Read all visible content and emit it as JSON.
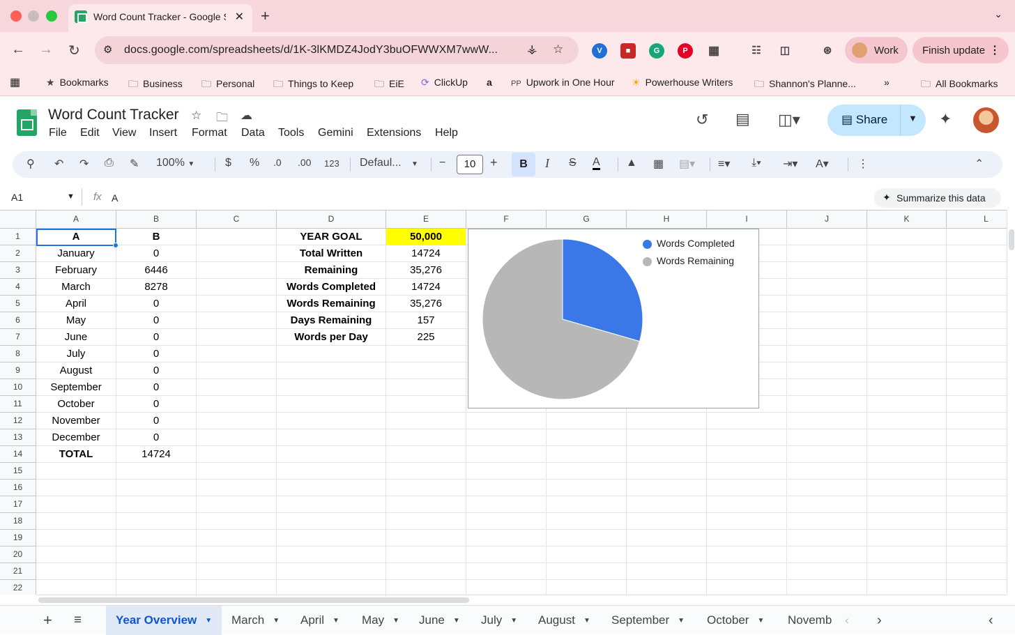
{
  "browser": {
    "tab_title": "Word Count Tracker - Google Sheets",
    "tab_close": "✕",
    "new_tab": "+",
    "url": "docs.google.com/spreadsheets/d/1K-3lKMDZ4JodY3buOFWWXM7wwW...",
    "profile_label": "Work",
    "update_label": "Finish update",
    "colors": {
      "tabstrip": "#f8d7dc",
      "toolbar": "#fde8eb"
    }
  },
  "bookmarks": [
    {
      "label": "Bookmarks",
      "icon": "star-icon"
    },
    {
      "label": "Business",
      "icon": "folder-icon"
    },
    {
      "label": "Personal",
      "icon": "folder-icon"
    },
    {
      "label": "Things to Keep",
      "icon": "folder-icon"
    },
    {
      "label": "EiE",
      "icon": "folder-icon"
    },
    {
      "label": "ClickUp",
      "icon": "clickup-icon"
    },
    {
      "label": "",
      "icon": "amazon-icon"
    },
    {
      "label": "Upwork in One Hour",
      "icon": "upwork-icon"
    },
    {
      "label": "Powerhouse Writers",
      "icon": "powerhouse-icon"
    },
    {
      "label": "Shannon's Planne...",
      "icon": "folder-icon"
    },
    {
      "label": "All Bookmarks",
      "icon": "folder-icon"
    }
  ],
  "sheets": {
    "doc_title": "Word Count Tracker",
    "menu": [
      "File",
      "Edit",
      "View",
      "Insert",
      "Format",
      "Data",
      "Tools",
      "Gemini",
      "Extensions",
      "Help"
    ],
    "share_label": "Share",
    "zoom": "100%",
    "currency": "$",
    "percent": "%",
    "dec_less": ".0",
    "dec_more": ".00",
    "number_format": "123",
    "font": "Defaul...",
    "font_size": "10",
    "name_box": "A1",
    "formula_value": "A",
    "summarize_label": "Summarize this data"
  },
  "grid": {
    "columns": [
      "A",
      "B",
      "C",
      "D",
      "E",
      "F",
      "G",
      "H",
      "I",
      "J",
      "K",
      "L"
    ],
    "rows": [
      "1",
      "2",
      "3",
      "4",
      "5",
      "6",
      "7",
      "8",
      "9",
      "10",
      "11",
      "12",
      "13",
      "14",
      "15",
      "16",
      "17",
      "18",
      "19",
      "20",
      "21",
      "22"
    ],
    "col_a": [
      "A",
      "January",
      "February",
      "March",
      "April",
      "May",
      "June",
      "July",
      "August",
      "September",
      "October",
      "November",
      "December",
      "TOTAL"
    ],
    "col_b": [
      "B",
      "0",
      "6446",
      "8278",
      "0",
      "0",
      "0",
      "0",
      "0",
      "0",
      "0",
      "0",
      "0",
      "14724"
    ],
    "col_d": [
      "YEAR GOAL",
      "Total Written",
      "Remaining",
      "Words Completed",
      "Words Remaining",
      "Days Remaining",
      "Words per Day"
    ],
    "col_e": [
      "50,000",
      "14724",
      "35,276",
      "14724",
      "35,276",
      "157",
      "225"
    ],
    "highlight_color": "#ffff00"
  },
  "chart_data": {
    "type": "pie",
    "labels": [
      "Words Completed",
      "Words Remaining"
    ],
    "values": [
      14724,
      35276
    ],
    "colors": [
      "#3b78e7",
      "#b7b7b7"
    ],
    "legend": "top-right"
  },
  "sheet_tabs": [
    "Year Overview",
    "March",
    "April",
    "May",
    "June",
    "July",
    "August",
    "September",
    "October",
    "Novemb"
  ]
}
